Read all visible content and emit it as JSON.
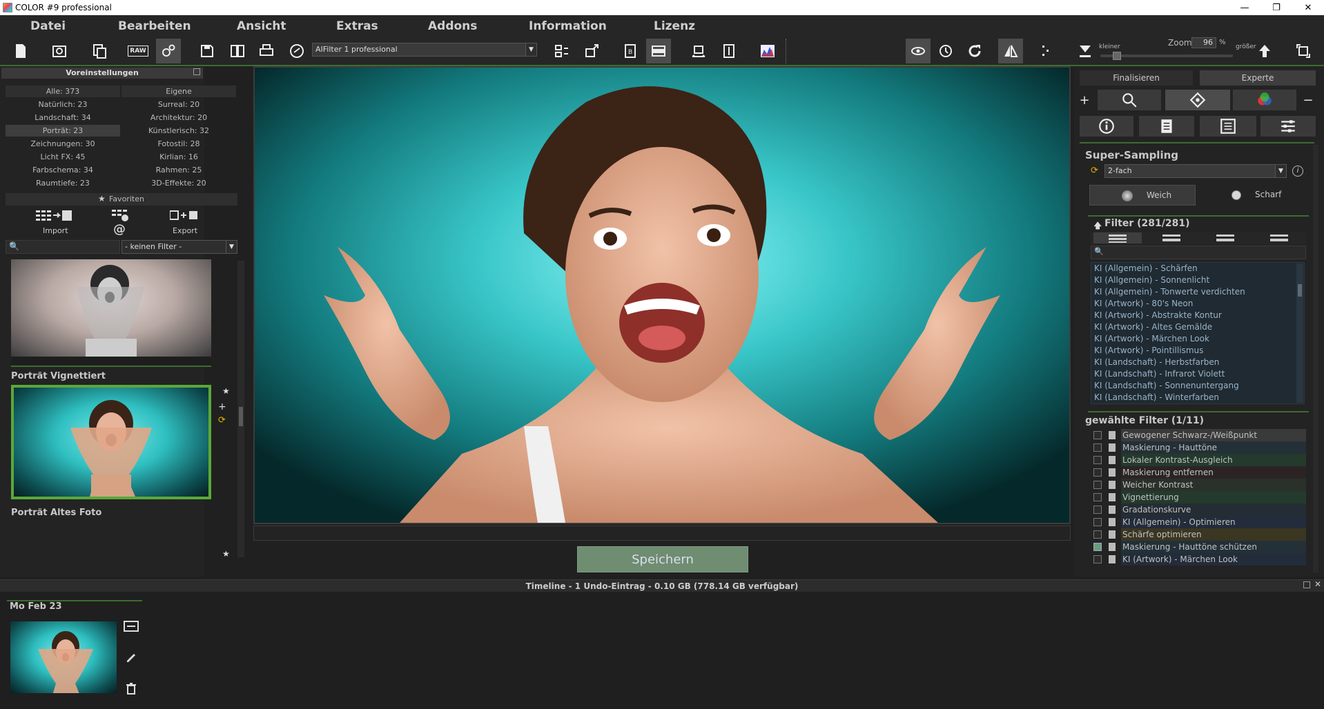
{
  "window": {
    "title": "COLOR #9 professional",
    "minimize": "—",
    "maximize": "❐",
    "close": "✕"
  },
  "menu": [
    "Datei",
    "Bearbeiten",
    "Ansicht",
    "Extras",
    "Addons",
    "Information",
    "Lizenz"
  ],
  "toolbar": {
    "filter_preset": "AIFilter 1 professional",
    "zoom_label": "Zoom",
    "zoom_value": "96",
    "zoom_unit": "%",
    "zoom_smaller": "kleiner",
    "zoom_larger": "größer",
    "raw_label": "RAW"
  },
  "left": {
    "header": "Voreinstellungen",
    "categories": [
      [
        "Alle: 373",
        "Eigene"
      ],
      [
        "Natürlich: 23",
        "Surreal: 20"
      ],
      [
        "Landschaft: 34",
        "Architektur: 20"
      ],
      [
        "Porträt: 23",
        "Künstlerisch: 32"
      ],
      [
        "Zeichnungen: 30",
        "Fotostil: 28"
      ],
      [
        "Licht FX: 45",
        "Kirlian: 16"
      ],
      [
        "Farbschema: 34",
        "Rahmen: 25"
      ],
      [
        "Raumtiefe: 23",
        "3D-Effekte: 20"
      ]
    ],
    "favorites": "Favoriten",
    "import": "Import",
    "at": "@",
    "export": "Export",
    "filter_select": "- keinen Filter -",
    "thumbs": [
      {
        "label": "Porträt Vignettiert"
      },
      {
        "label": "Porträt Altes Foto"
      }
    ]
  },
  "center": {
    "save": "Speichern"
  },
  "right": {
    "tab_finalize": "Finalisieren",
    "tab_expert": "Experte",
    "supersampling_title": "Super-Sampling",
    "supersampling_value": "2-fach",
    "soft": "Weich",
    "sharp": "Scharf",
    "filter_title": "Filter (281/281)",
    "filters": [
      "KI (Allgemein) - Schärfen",
      "KI (Allgemein) - Sonnenlicht",
      "KI (Allgemein) - Tonwerte verdichten",
      "KI (Artwork) - 80's Neon",
      "KI (Artwork) - Abstrakte Kontur",
      "KI (Artwork) - Altes Gemälde",
      "KI (Artwork) - Märchen Look",
      "KI (Artwork) - Pointillismus",
      "KI (Landschaft) - Herbstfarben",
      "KI (Landschaft) - Infrarot Violett",
      "KI (Landschaft) - Sonnenuntergang",
      "KI (Landschaft) - Winterfarben"
    ],
    "selected_title": "gewählte Filter (1/11)",
    "selected": [
      {
        "label": "Gewogener Schwarz-/Weißpunkt",
        "checked": false,
        "bg": "#3a3a3a"
      },
      {
        "label": "Maskierung - Hauttöne",
        "checked": false,
        "bg": "#243038"
      },
      {
        "label": "Lokaler Kontrast-Ausgleich",
        "checked": false,
        "bg": "#233a2c"
      },
      {
        "label": "Maskierung entfernen",
        "checked": false,
        "bg": "#2c2424"
      },
      {
        "label": "Weicher Kontrast",
        "checked": false,
        "bg": "#2a302a"
      },
      {
        "label": "Vignettierung",
        "checked": false,
        "bg": "#233a2c"
      },
      {
        "label": "Gradationskurve",
        "checked": false,
        "bg": "#242c34"
      },
      {
        "label": "KI (Allgemein) - Optimieren",
        "checked": false,
        "bg": "#232c3a"
      },
      {
        "label": "Schärfe optimieren",
        "checked": false,
        "bg": "#3a3622"
      },
      {
        "label": "Maskierung - Hauttöne schützen",
        "checked": true,
        "bg": "#243038"
      },
      {
        "label": "KI (Artwork) - Märchen Look",
        "checked": false,
        "bg": "#232c3a"
      }
    ]
  },
  "timeline": {
    "bar": "Timeline - 1 Undo-Eintrag - 0.10 GB (778.14 GB verfügbar)",
    "date": "Mo Feb 23"
  }
}
